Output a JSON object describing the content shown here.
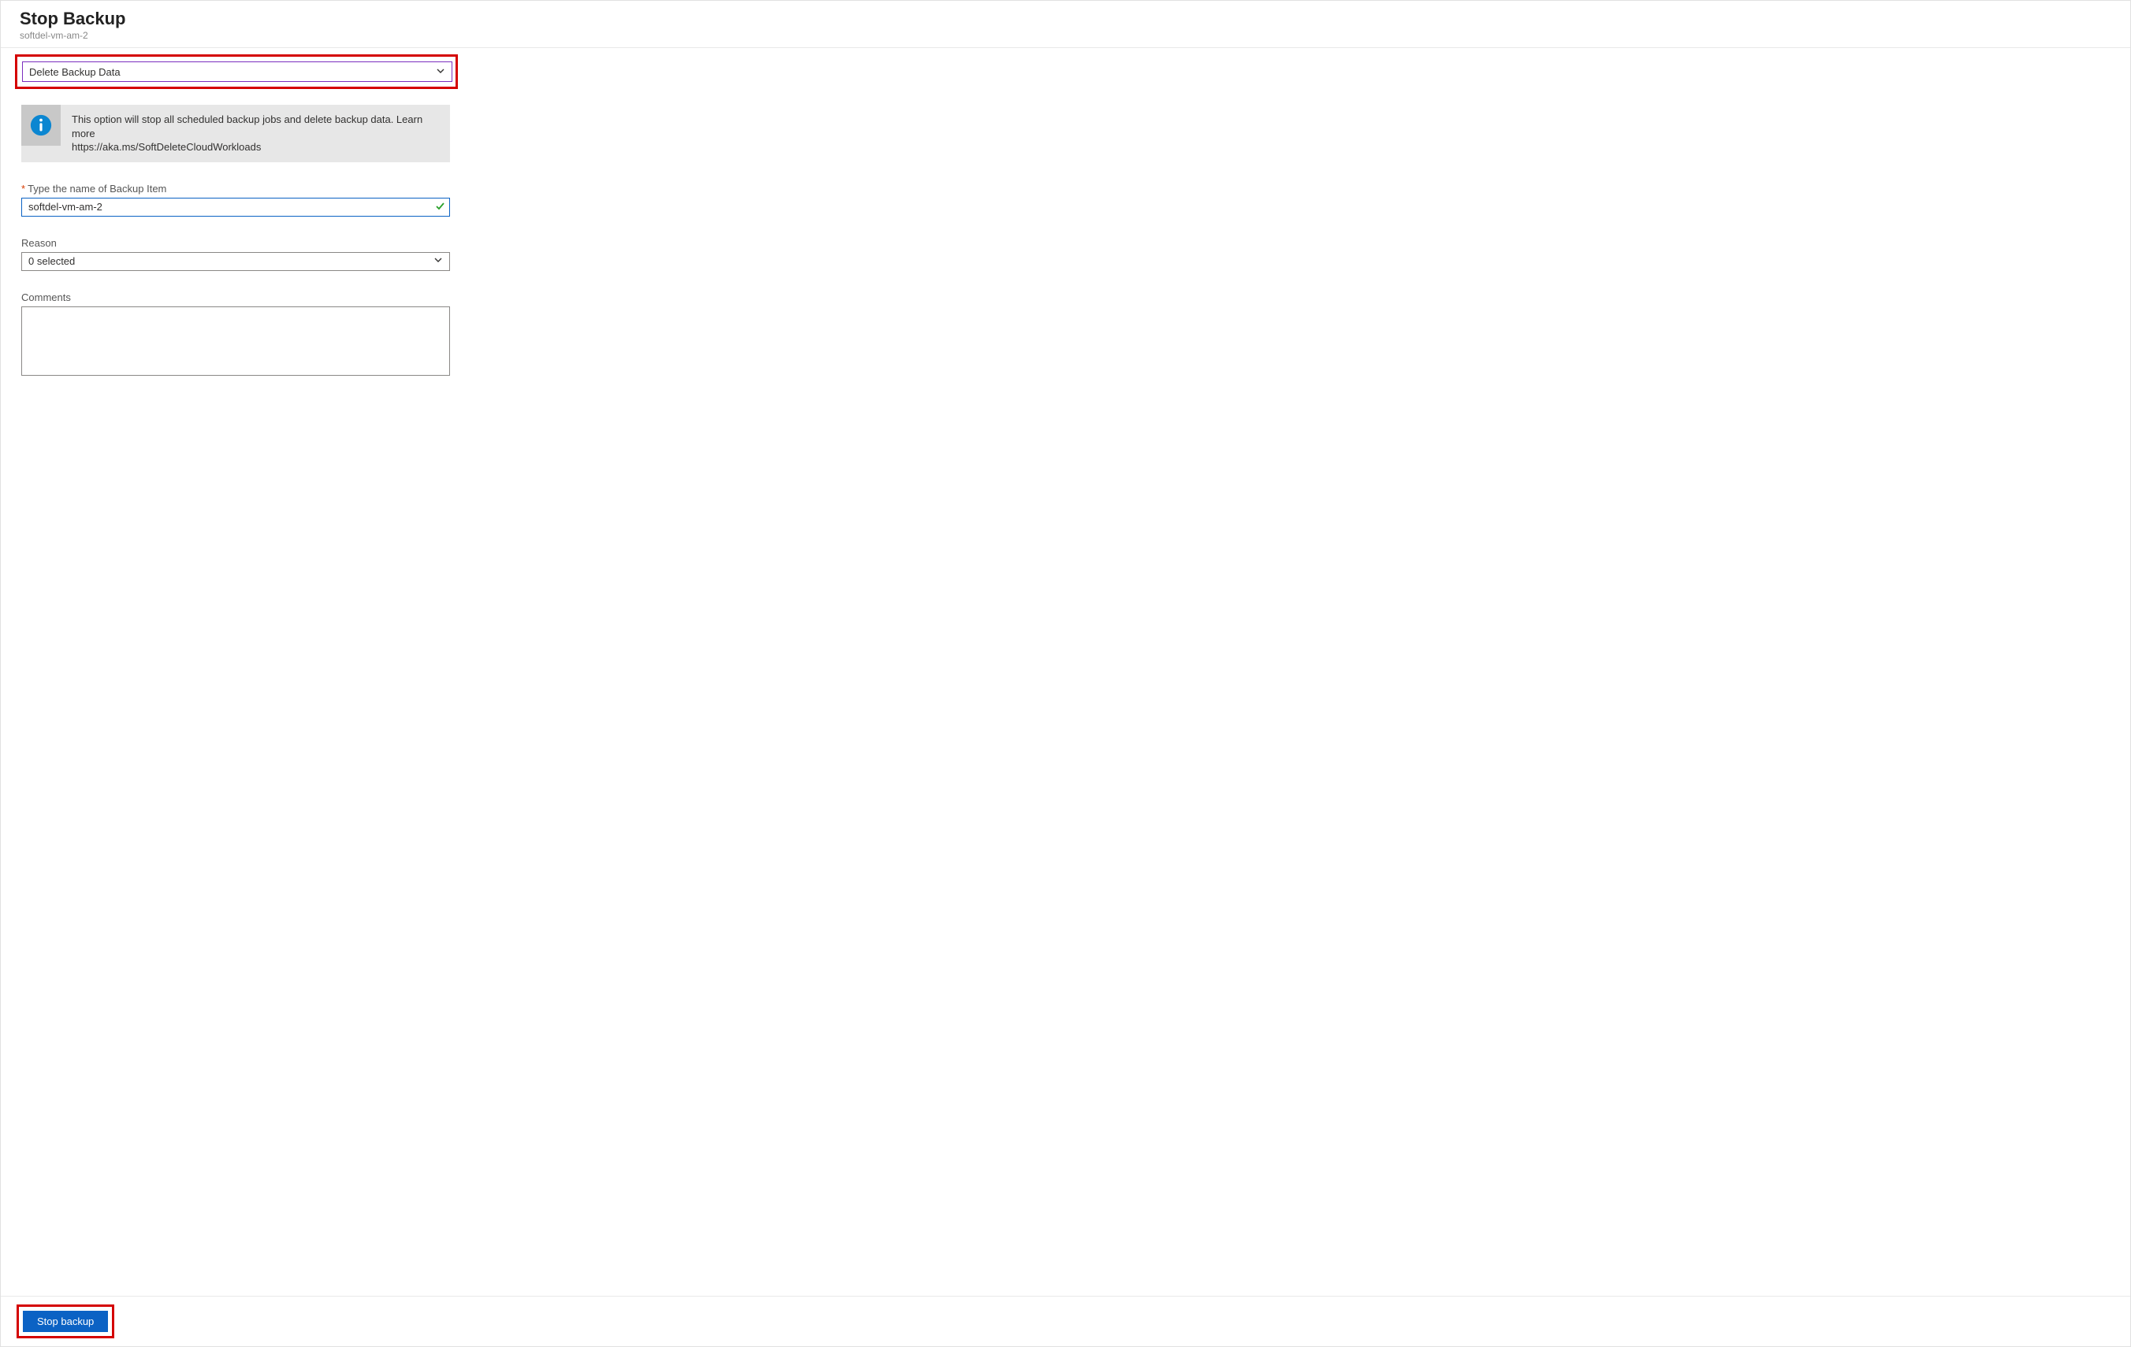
{
  "header": {
    "title": "Stop Backup",
    "subtitle": "softdel-vm-am-2"
  },
  "actionDropdown": {
    "selected": "Delete Backup Data"
  },
  "infoBox": {
    "text": "This option will stop all scheduled backup jobs and delete backup data. Learn more",
    "link": "https://aka.ms/SoftDeleteCloudWorkloads"
  },
  "nameField": {
    "label": "Type the name of Backup Item",
    "value": "softdel-vm-am-2"
  },
  "reasonField": {
    "label": "Reason",
    "selected": "0 selected"
  },
  "commentsField": {
    "label": "Comments",
    "value": ""
  },
  "footer": {
    "stopButton": "Stop backup"
  }
}
